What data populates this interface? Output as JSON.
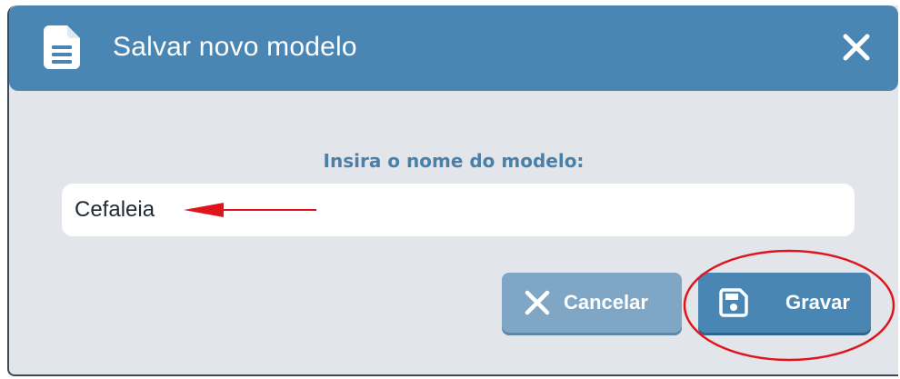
{
  "dialog": {
    "title": "Salvar novo modelo",
    "header_icon": "document-icon",
    "close_icon": "close-icon"
  },
  "form": {
    "prompt": "Insira o nome do modelo:",
    "name_value": "Cefaleia",
    "name_placeholder": ""
  },
  "actions": {
    "cancel_label": "Cancelar",
    "cancel_icon": "x-icon",
    "save_label": "Gravar",
    "save_icon": "floppy-disk-icon"
  },
  "annotations": {
    "arrow_icon": "red-arrow-icon",
    "highlight_icon": "red-ellipse-highlight"
  },
  "colors": {
    "header": "#4a86b4",
    "dialog_bg": "#e2e6ea",
    "cancel_button": "#7fa6c4",
    "save_button": "#4a86b4",
    "prompt_text": "#4a7fa8",
    "annotation": "#e0141c"
  }
}
